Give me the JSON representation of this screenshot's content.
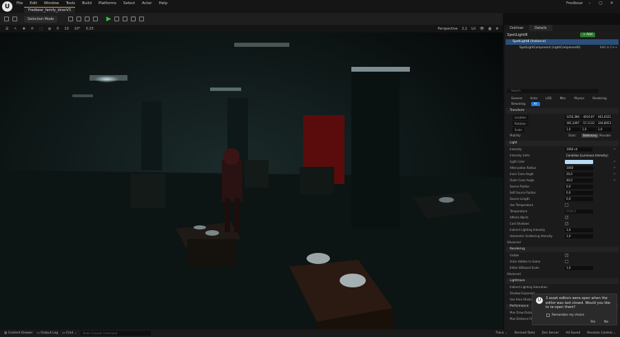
{
  "menu": [
    "File",
    "Edit",
    "Window",
    "Tools",
    "Build",
    "Platforms",
    "Select",
    "Actor",
    "Help"
  ],
  "app_title": "Fredbear",
  "map_tab": "Fredbear_family_dinerV3",
  "toolbar": {
    "selection_mode": "Selection Mode"
  },
  "viewport_bar": {
    "perspective": "Perspective",
    "lit": "Lit",
    "grid": "10",
    "angle": "10°",
    "scale": "0.25",
    "snap": "0",
    "cam_speed": "2,1"
  },
  "panels": {
    "outliner_tab": "Outliner",
    "details_tab": "Details"
  },
  "details": {
    "actor_name": "SpotLight8",
    "add_label": "+ Add",
    "component_instance": "SpotLight8 (Instance)",
    "component_child": "SpotLightComponent (LightComponent0)",
    "edit_cpp": "Edit in C++",
    "search_placeholder": "Search",
    "filters": [
      "General",
      "Actor",
      "LOD",
      "Misc",
      "Physics",
      "Rendering",
      "Streaming",
      "All"
    ],
    "active_filter": "All",
    "transform": {
      "title": "Transform",
      "location_label": "Location",
      "location": [
        "1250,380",
        "-4016,97",
        "461,6521"
      ],
      "rotation_label": "Rotation",
      "rotation": [
        "181,3497",
        "-57,1132",
        "344,8053"
      ],
      "scale_label": "Scale",
      "scale": [
        "1,0",
        "1,0",
        "1,0"
      ],
      "mobility_label": "Mobility",
      "mobility": [
        "Static",
        "Stationary",
        "Movable"
      ],
      "mobility_selected": "Stationary"
    },
    "light": {
      "title": "Light",
      "intensity_label": "Intensity",
      "intensity": "1060 cd",
      "units_label": "Intensity Units",
      "units": "Candelas (Luminous Intensity)",
      "color_label": "Light Color",
      "radius_label": "Attenuation Radius",
      "radius": "1060",
      "inner_label": "Inner Cone Angle",
      "inner": "20,0",
      "outer_label": "Outer Cone Angle",
      "outer": "40,0",
      "source_radius_label": "Source Radius",
      "source_radius": "0,0",
      "soft_radius_label": "Soft Source Radius",
      "soft_radius": "0,0",
      "source_length_label": "Source Length",
      "source_length": "0,0",
      "use_temp_label": "Use Temperature",
      "temp_label": "Temperature",
      "temp": "6500,0",
      "affects_world_label": "Affects World",
      "cast_shadows_label": "Cast Shadows",
      "indirect_label": "Indirect Lighting Intensity",
      "indirect": "1,0",
      "volumetric_label": "Volumetric Scattering Intensity",
      "volumetric": "1,0",
      "advanced_label": "Advanced"
    },
    "rendering": {
      "title": "Rendering",
      "visible_label": "Visible",
      "hidden_label": "Actor Hidden In Game",
      "billboard_label": "Editor Billboard Scale",
      "billboard": "1,0",
      "advanced_label": "Advanced"
    },
    "lightmass": {
      "title": "Lightmass",
      "indirect_label": "Indirect Lighting Saturation",
      "shadow_label": "Shadow Exponent",
      "area_label": "Use Area Shadows For Stationary Light"
    },
    "performance": {
      "title": "Performance",
      "max_draw_label": "Max Draw Distance",
      "max_fade_label": "Max Distance Fade Range"
    }
  },
  "notification": {
    "message": "3 asset editors were open when the editor was last closed. Would you like to re-open them?",
    "remember": "Remember my choice",
    "yes": "Yes",
    "no": "No"
  },
  "statusbar": {
    "content_drawer": "Content Drawer",
    "output_log": "Output Log",
    "cmd": "Cmd",
    "cmd_placeholder": "Enter Console Command",
    "trace": "Trace",
    "derived_data": "Derived Data",
    "zen_server": "Zen Server",
    "all_saved": "All Saved",
    "revision": "Revision Control"
  }
}
